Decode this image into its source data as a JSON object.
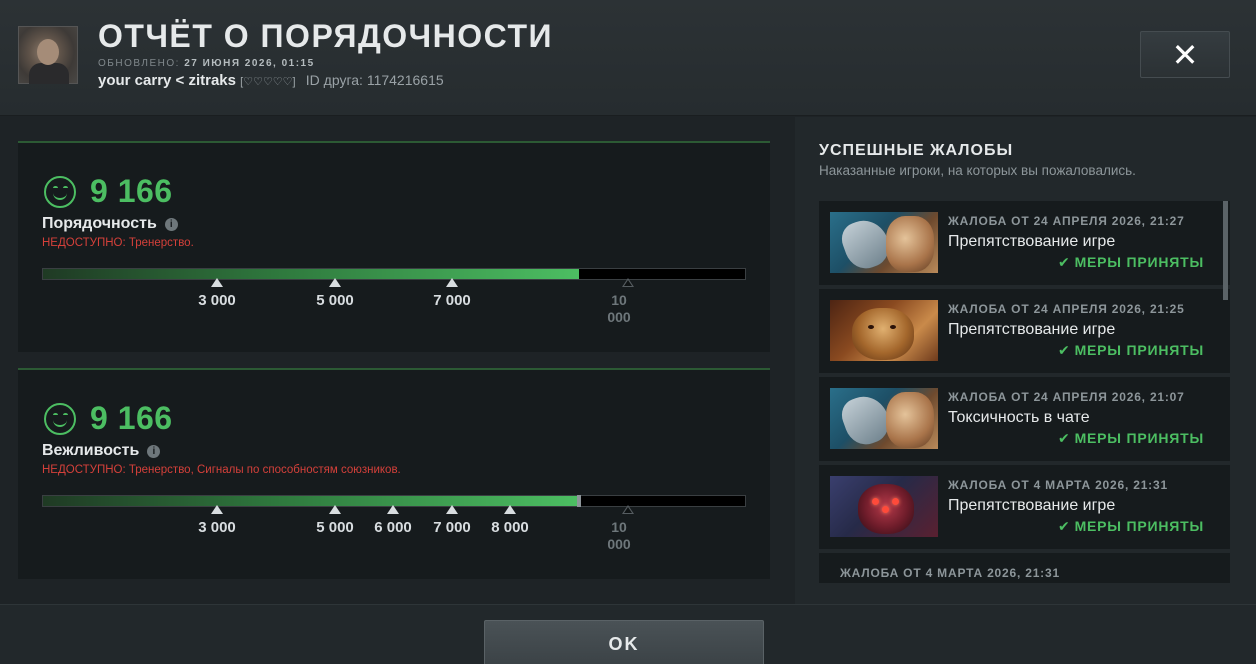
{
  "header": {
    "title": "ОТЧЁТ О ПОРЯДОЧНОСТИ",
    "updated_label": "ОБНОВЛЕНО:",
    "updated_value": "27 ИЮНЯ 2026, 01:15",
    "player_name": "your carry < zitraks",
    "hearts": "[♡♡♡♡♡]",
    "friend_id": "ID друга: 1174216615",
    "close_symbol": "✕"
  },
  "conduct": {
    "score": "9 166",
    "label": "Порядочность",
    "unavailable": "НЕДОСТУПНО:  Тренерство.",
    "progress_fraction": 0.9166,
    "ticks": [
      "3 000",
      "5 000",
      "7 000"
    ],
    "max_tick": "10 000"
  },
  "politeness": {
    "score": "9 166",
    "label": "Вежливость",
    "unavailable": "НЕДОСТУПНО:  Тренерство, Сигналы по способностям союзников.",
    "progress_fraction": 0.9166,
    "ticks": [
      "3 000",
      "5 000",
      "6 000",
      "7 000",
      "8 000"
    ],
    "max_tick": "10 000"
  },
  "reports": {
    "title": "УСПЕШНЫЕ ЖАЛОБЫ",
    "subtitle": "Наказанные игроки, на которых вы пожаловались.",
    "items": [
      {
        "meta": "ЖАЛОБА ОТ 24 АПРЕЛЯ 2026, 21:27",
        "reason": "Препятствование игре",
        "status": "МЕРЫ ПРИНЯТЫ",
        "hero_icon": "tusk-portrait"
      },
      {
        "meta": "ЖАЛОБА ОТ 24 АПРЕЛЯ 2026, 21:25",
        "reason": "Препятствование игре",
        "status": "МЕРЫ ПРИНЯТЫ",
        "hero_icon": "beastmaster-portrait"
      },
      {
        "meta": "ЖАЛОБА ОТ 24 АПРЕЛЯ 2026, 21:07",
        "reason": "Токсичность в чате",
        "status": "МЕРЫ ПРИНЯТЫ",
        "hero_icon": "tusk-portrait"
      },
      {
        "meta": "ЖАЛОБА ОТ 4 МАРТА 2026, 21:31",
        "reason": "Препятствование игре",
        "status": "МЕРЫ ПРИНЯТЫ",
        "hero_icon": "broodmother-portrait"
      },
      {
        "meta": "ЖАЛОБА ОТ 4 МАРТА 2026, 21:31"
      }
    ]
  },
  "footer": {
    "ok_label": "OK"
  },
  "colors": {
    "accent_green": "#4cbe62",
    "warning_red": "#d4403a",
    "background": "#1e2326"
  }
}
